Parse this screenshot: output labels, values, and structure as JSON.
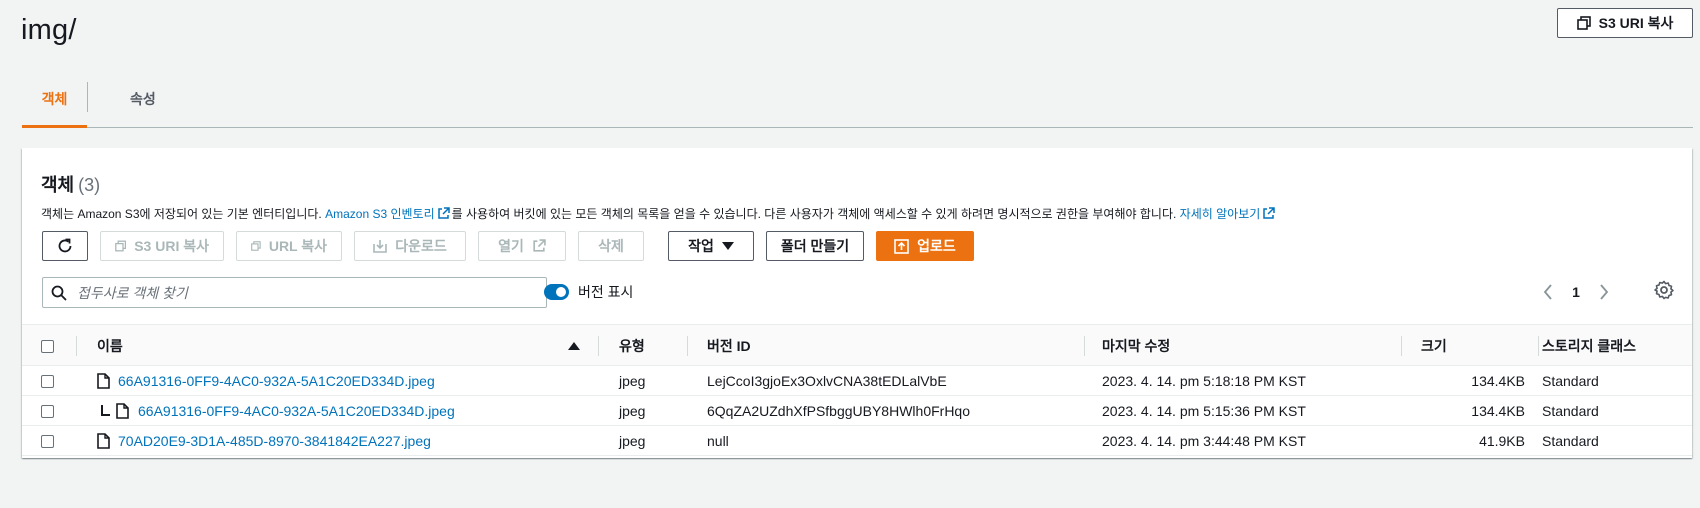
{
  "page": {
    "title": "img/"
  },
  "header": {
    "copy_s3_uri_label": "S3 URI 복사"
  },
  "tabs": [
    {
      "label": "객체",
      "active": true
    },
    {
      "label": "속성",
      "active": false
    }
  ],
  "objects_panel": {
    "title": "객체",
    "count": "(3)",
    "description": {
      "part1": "객체는 Amazon S3에 저장되어 있는 기본 엔터티입니다. ",
      "inventory_link": "Amazon S3 인벤토리",
      "part2": "를 사용하여 버킷에 있는 모든 객체의 목록을 얻을 수 있습니다. 다른 사용자가 객체에 액세스할 수 있게 하려면 명시적으로 권한을 부여해야 합니다. ",
      "learn_more_link": "자세히 알아보기"
    },
    "toolbar": {
      "copy_s3_uri": "S3 URI 복사",
      "copy_url": "URL 복사",
      "download": "다운로드",
      "open": "열기",
      "delete": "삭제",
      "actions": "작업",
      "create_folder": "폴더 만들기",
      "upload": "업로드"
    },
    "search": {
      "placeholder": "접두사로 객체 찾기",
      "value": ""
    },
    "show_versions": {
      "label": "버전 표시",
      "enabled": true
    },
    "pagination": {
      "current_page": "1"
    },
    "table": {
      "columns": {
        "name": "이름",
        "type": "유형",
        "version_id": "버전 ID",
        "last_modified": "마지막 수정",
        "size": "크기",
        "storage_class": "스토리지 클래스"
      },
      "rows": [
        {
          "name": "66A91316-0FF9-4AC0-932A-5A1C20ED334D.jpeg",
          "type": "jpeg",
          "version_id": "LejCcoI3gjoEx3OxlvCNA38tEDLalVbE",
          "last_modified": "2023. 4. 14. pm 5:18:18 PM KST",
          "size": "134.4KB",
          "storage_class": "Standard"
        },
        {
          "name": "66A91316-0FF9-4AC0-932A-5A1C20ED334D.jpeg",
          "type": "jpeg",
          "version_id": "6QqZA2UZdhXfPSfbggUBY8HWlh0FrHqo",
          "last_modified": "2023. 4. 14. pm 5:15:36 PM KST",
          "size": "134.4KB",
          "storage_class": "Standard"
        },
        {
          "name": "70AD20E9-3D1A-485D-8970-3841842EA227.jpeg",
          "type": "jpeg",
          "version_id": "null",
          "last_modified": "2023. 4. 14. pm 3:44:48 PM KST",
          "size": "41.9KB",
          "storage_class": "Standard"
        }
      ]
    }
  },
  "colors": {
    "accent": "#ec7211",
    "link": "#0073bb",
    "toggle_on": "#0073bb"
  }
}
